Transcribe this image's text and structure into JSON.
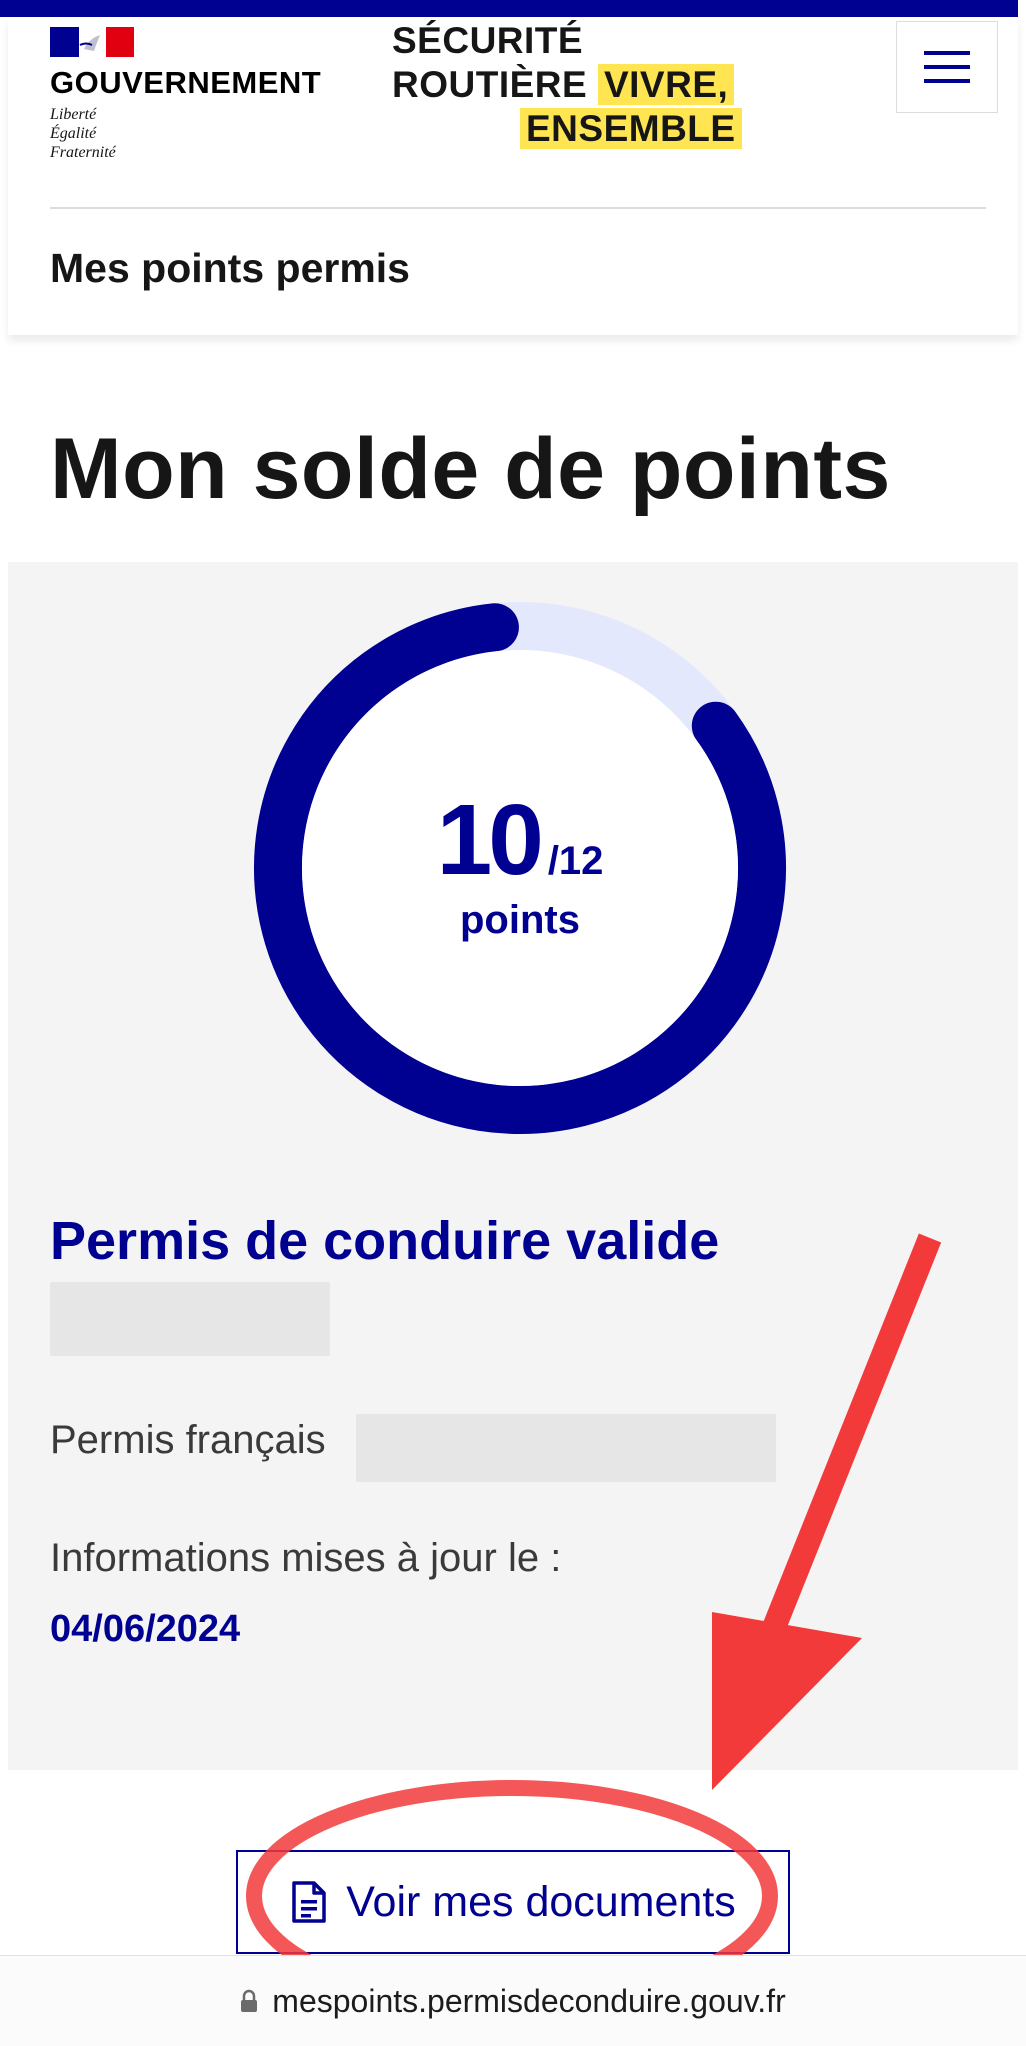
{
  "header": {
    "government": "GOUVERNEMENT",
    "motto": [
      "Liberté",
      "Égalité",
      "Fraternité"
    ],
    "brand": {
      "line1": "SÉCURITÉ",
      "line2": "ROUTIÈRE",
      "line2_highlight": "VIVRE,",
      "line3_highlight": "ENSEMBLE"
    },
    "service_name": "Mes points permis",
    "menu_icon": "hamburger-menu-icon"
  },
  "page_title": "Mon solde de points",
  "balance": {
    "points": 10,
    "max_points": 12,
    "points_text": "10",
    "max_text": "/12",
    "unit": "points",
    "colors": {
      "filled": "#000091",
      "empty": "#e3e8fc"
    }
  },
  "license": {
    "status": "Permis de conduire valide",
    "type_label": "Permis français",
    "updated_label": "Informations mises à jour le :",
    "updated_date": "04/06/2024"
  },
  "actions": {
    "documents_label": "Voir mes documents",
    "documents_icon": "document-icon"
  },
  "browser": {
    "url": "mespoints.permisdeconduire.gouv.fr",
    "lock_icon": "lock-icon"
  },
  "annotation": {
    "color": "#f23a3a",
    "shapes": [
      "arrow",
      "ellipse"
    ]
  },
  "colors": {
    "primary": "#000091",
    "highlight": "#ffe552",
    "card_background": "#f4f4f4"
  }
}
